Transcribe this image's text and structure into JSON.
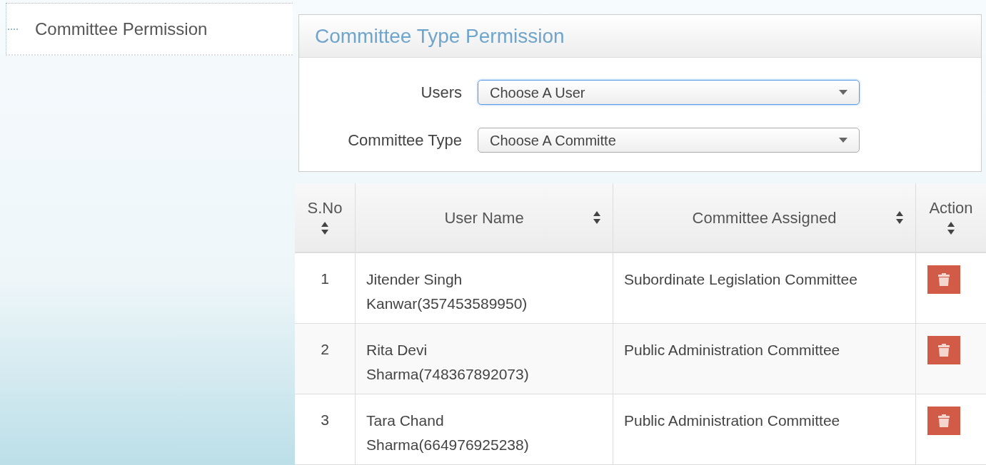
{
  "sidebar": {
    "items": [
      {
        "label": "Committee Permission"
      }
    ]
  },
  "panel": {
    "title": "Committee Type Permission",
    "fields": [
      {
        "label": "Users",
        "placeholder": "Choose A User",
        "focused": true
      },
      {
        "label": "Committee Type",
        "placeholder": "Choose A Committe",
        "focused": false
      }
    ]
  },
  "table": {
    "columns": [
      {
        "label": "S.No"
      },
      {
        "label": "User Name"
      },
      {
        "label": "Committee Assigned"
      },
      {
        "label": "Action"
      }
    ],
    "rows": [
      {
        "sno": "1",
        "user": "Jitender Singh Kanwar(357453589950)",
        "committee": "Subordinate Legislation Committee"
      },
      {
        "sno": "2",
        "user": "Rita Devi Sharma(748367892073)",
        "committee": "Public Administration Committee"
      },
      {
        "sno": "3",
        "user": "Tara Chand Sharma(664976925238)",
        "committee": "Public Administration Committee"
      }
    ]
  }
}
